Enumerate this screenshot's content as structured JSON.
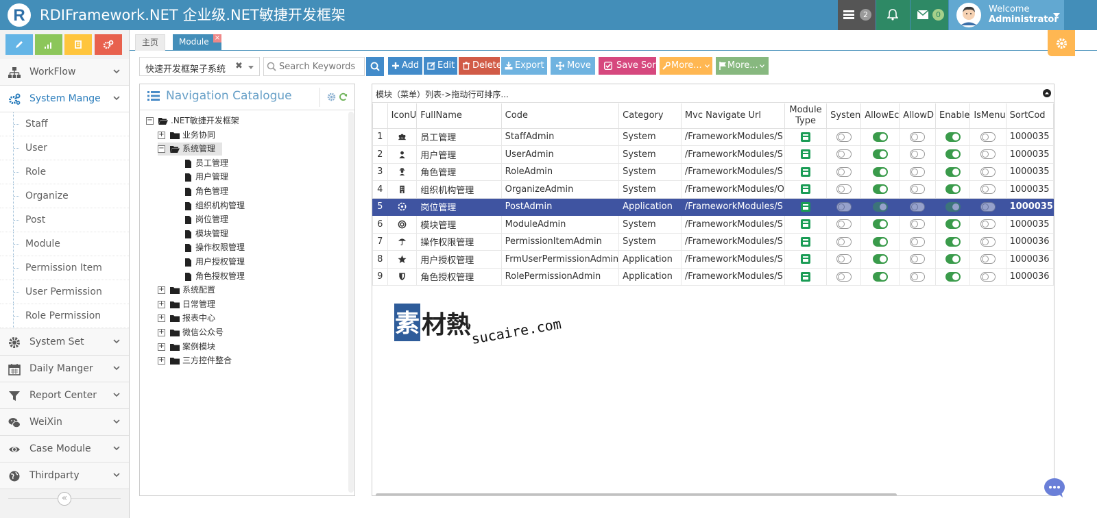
{
  "app": {
    "title": "RDIFramework.NET 企业级.NET敏捷开发框架",
    "logo_letter": "R"
  },
  "header": {
    "tasks_count": "2",
    "messages_count": "0",
    "welcome_label": "Welcome",
    "user_name": "Administrator",
    "colors": {
      "bar": "#438eb9",
      "tasks": "#555555",
      "notify": "#2e8965",
      "messages": "#2e8965"
    }
  },
  "shortcuts": [
    {
      "icon": "pencil-icon",
      "color": "#64b5e6"
    },
    {
      "icon": "signal-icon",
      "color": "#8cc65a"
    },
    {
      "icon": "book-icon",
      "color": "#ffc53d"
    },
    {
      "icon": "cogs-icon",
      "color": "#e8614d"
    }
  ],
  "menu": {
    "workflow": "WorkFlow",
    "system_mange": "System Mange",
    "sub": [
      "Staff",
      "User",
      "Role",
      "Organize",
      "Post",
      "Module",
      "Permission Item",
      "User Permission",
      "Role Permission"
    ],
    "system_set": "System Set",
    "daily": "Daily Manger",
    "report": "Report Center",
    "weixin": "WeiXin",
    "case": "Case Module",
    "third": "Thirdparty",
    "collapse": "«"
  },
  "tabs": {
    "home": "主页",
    "module": "Module",
    "close": "×"
  },
  "toolbar": {
    "system_select": "快速开发框架子系统",
    "clear": "✖",
    "search_placeholder": "Search Keywords",
    "add": "Add",
    "edit": "Edit",
    "delete": "Delete",
    "export": "Export",
    "move": "Move",
    "save_sort": "Save Sort",
    "more1": "More...",
    "more2": "More...",
    "colors": {
      "add": "#428bca",
      "edit": "#428bca",
      "delete": "#d15b47",
      "export": "#6fb3e0",
      "move": "#6fb3e0",
      "save": "#d6487e",
      "more1": "#ffb752",
      "more2": "#87b87f"
    }
  },
  "nav": {
    "title": "Navigation Catalogue",
    "root": ".NET敏捷开发框架",
    "groups_before": [
      "业务协同"
    ],
    "open_group": "系统管理",
    "children": [
      "员工管理",
      "用户管理",
      "角色管理",
      "组织机构管理",
      "岗位管理",
      "模块管理",
      "操作权限管理",
      "用户授权管理",
      "角色授权管理"
    ],
    "groups_after": [
      "系统配置",
      "日常管理",
      "报表中心",
      "微信公众号",
      "案例模块",
      "三方控件整合"
    ]
  },
  "grid": {
    "caption": "模块（菜单）列表->拖动行可排序...",
    "columns": [
      "IconU",
      "FullName",
      "Code",
      "Category",
      "Mvc Navigate Url",
      "Module Type",
      "Systen",
      "AllowEc",
      "AllowD",
      "Enable",
      "IsMenu",
      "SortCod"
    ],
    "rows": [
      {
        "n": "1",
        "icon": "users-icon",
        "name": "员工管理",
        "code": "StaffAdmin",
        "cat": "System",
        "url": "/FrameworkModules/S",
        "sys": false,
        "edit": true,
        "del": false,
        "en": true,
        "menu": false,
        "sort": "1000035"
      },
      {
        "n": "2",
        "icon": "user-icon",
        "name": "用户管理",
        "code": "UserAdmin",
        "cat": "System",
        "url": "/FrameworkModules/S",
        "sys": false,
        "edit": true,
        "del": false,
        "en": true,
        "menu": false,
        "sort": "1000035"
      },
      {
        "n": "3",
        "icon": "user-secret-icon",
        "name": "角色管理",
        "code": "RoleAdmin",
        "cat": "System",
        "url": "/FrameworkModules/S",
        "sys": false,
        "edit": true,
        "del": false,
        "en": true,
        "menu": false,
        "sort": "1000035"
      },
      {
        "n": "4",
        "icon": "building-icon",
        "name": "组织机构管理",
        "code": "OrganizeAdmin",
        "cat": "System",
        "url": "/FrameworkModules/O",
        "sys": false,
        "edit": true,
        "del": false,
        "en": true,
        "menu": false,
        "sort": "1000035"
      },
      {
        "n": "5",
        "icon": "rebel-icon",
        "name": "岗位管理",
        "code": "PostAdmin",
        "cat": "Application",
        "url": "/FrameworkModules/S",
        "sys": false,
        "edit": true,
        "del": false,
        "en": true,
        "menu": false,
        "sort": "1000035",
        "selected": true
      },
      {
        "n": "6",
        "icon": "module-icon",
        "name": "模块管理",
        "code": "ModuleAdmin",
        "cat": "System",
        "url": "/FrameworkModules/S",
        "sys": false,
        "edit": true,
        "del": false,
        "en": true,
        "menu": false,
        "sort": "1000035"
      },
      {
        "n": "7",
        "icon": "umbrella-icon",
        "name": "操作权限管理",
        "code": "PermissionItemAdmin",
        "cat": "System",
        "url": "/FrameworkModules/S",
        "sys": false,
        "edit": true,
        "del": false,
        "en": true,
        "menu": false,
        "sort": "1000036"
      },
      {
        "n": "8",
        "icon": "star-icon",
        "name": "用户授权管理",
        "code": "FrmUserPermissionAdmin",
        "cat": "Application",
        "url": "/FrameworkModules/S",
        "sys": false,
        "edit": true,
        "del": false,
        "en": true,
        "menu": false,
        "sort": "1000036"
      },
      {
        "n": "9",
        "icon": "shield-icon",
        "name": "角色授权管理",
        "code": "RolePermissionAdmin",
        "cat": "Application",
        "url": "/FrameworkModules/S",
        "sys": false,
        "edit": true,
        "del": false,
        "en": true,
        "menu": false,
        "sort": "1000036"
      }
    ]
  },
  "watermark": {
    "cn": "素材熱",
    "en": "sucaire.com"
  }
}
